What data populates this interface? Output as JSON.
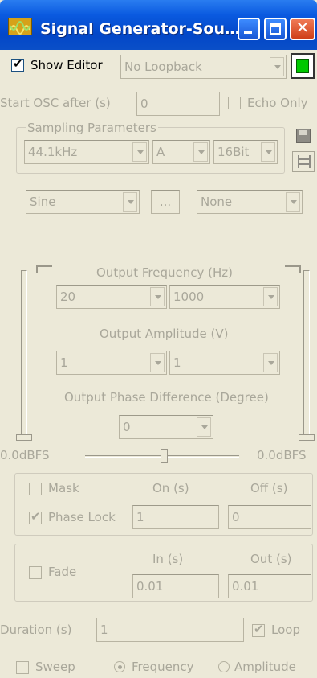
{
  "window": {
    "title": "Signal Generator-Sou…"
  },
  "top": {
    "show_editor": "Show Editor",
    "loopback": "No Loopback",
    "start_osc": "Start OSC after (s)",
    "start_osc_value": "0",
    "echo_only": "Echo Only"
  },
  "sampling": {
    "title": "Sampling Parameters",
    "rate": "44.1kHz",
    "channel": "A",
    "bits": "16Bit"
  },
  "wave": {
    "type": "Sine",
    "more": "...",
    "mod": "None"
  },
  "output": {
    "freq_label": "Output Frequency (Hz)",
    "freq_a": "20",
    "freq_b": "1000",
    "amp_label": "Output Amplitude (V)",
    "amp_a": "1",
    "amp_b": "1",
    "phase_label": "Output Phase Difference (Degree)",
    "phase": "0",
    "left_dbfs": "0.0dBFS",
    "right_dbfs": "0.0dBFS"
  },
  "mask": {
    "mask": "Mask",
    "on_label": "On (s)",
    "off_label": "Off (s)",
    "phase_lock": "Phase Lock",
    "on_value": "1",
    "off_value": "0"
  },
  "fade": {
    "fade": "Fade",
    "in_label": "In (s)",
    "out_label": "Out (s)",
    "in_value": "0.01",
    "out_value": "0.01"
  },
  "duration": {
    "label": "Duration (s)",
    "value": "1",
    "loop": "Loop"
  },
  "sweep": {
    "sweep": "Sweep",
    "frequency": "Frequency",
    "amplitude": "Amplitude"
  },
  "colors": {
    "titlebar": "#0a5ae0",
    "green_led": "#00c800",
    "disabled_text": "#a9a79a"
  }
}
